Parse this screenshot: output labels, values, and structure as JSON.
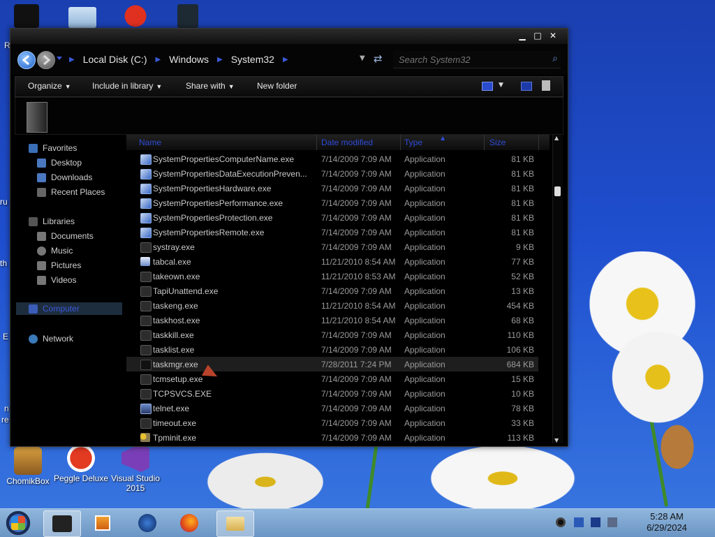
{
  "window": {
    "controls": {
      "minimize": "▁",
      "maximize": "□",
      "close": "✕"
    }
  },
  "breadcrumb": [
    "Local Disk (C:)",
    "Windows",
    "System32"
  ],
  "search": {
    "placeholder": "Search System32"
  },
  "toolbar": {
    "organize": "Organize",
    "include": "Include in library",
    "share": "Share with",
    "new_folder": "New folder"
  },
  "nav": {
    "favorites": "Favorites",
    "desktop": "Desktop",
    "downloads": "Downloads",
    "recent": "Recent Places",
    "libraries": "Libraries",
    "documents": "Documents",
    "music": "Music",
    "pictures": "Pictures",
    "videos": "Videos",
    "computer": "Computer",
    "network": "Network"
  },
  "columns": {
    "name": "Name",
    "date": "Date modified",
    "type": "Type",
    "size": "Size"
  },
  "files": [
    {
      "name": "SystemPropertiesComputerName.exe",
      "date": "7/14/2009 7:09 AM",
      "type": "Application",
      "size": "81 KB",
      "icon": "sysprop"
    },
    {
      "name": "SystemPropertiesDataExecutionPreven...",
      "date": "7/14/2009 7:09 AM",
      "type": "Application",
      "size": "81 KB",
      "icon": "sysprop"
    },
    {
      "name": "SystemPropertiesHardware.exe",
      "date": "7/14/2009 7:09 AM",
      "type": "Application",
      "size": "81 KB",
      "icon": "sysprop"
    },
    {
      "name": "SystemPropertiesPerformance.exe",
      "date": "7/14/2009 7:09 AM",
      "type": "Application",
      "size": "81 KB",
      "icon": "sysprop"
    },
    {
      "name": "SystemPropertiesProtection.exe",
      "date": "7/14/2009 7:09 AM",
      "type": "Application",
      "size": "81 KB",
      "icon": "sysprop"
    },
    {
      "name": "SystemPropertiesRemote.exe",
      "date": "7/14/2009 7:09 AM",
      "type": "Application",
      "size": "81 KB",
      "icon": "sysprop"
    },
    {
      "name": "systray.exe",
      "date": "7/14/2009 7:09 AM",
      "type": "Application",
      "size": "9 KB",
      "icon": "exe"
    },
    {
      "name": "tabcal.exe",
      "date": "11/21/2010 8:54 AM",
      "type": "Application",
      "size": "77 KB",
      "icon": "tabcal"
    },
    {
      "name": "takeown.exe",
      "date": "11/21/2010 8:53 AM",
      "type": "Application",
      "size": "52 KB",
      "icon": "exe"
    },
    {
      "name": "TapiUnattend.exe",
      "date": "7/14/2009 7:09 AM",
      "type": "Application",
      "size": "13 KB",
      "icon": "exe"
    },
    {
      "name": "taskeng.exe",
      "date": "11/21/2010 8:54 AM",
      "type": "Application",
      "size": "454 KB",
      "icon": "exe"
    },
    {
      "name": "taskhost.exe",
      "date": "11/21/2010 8:54 AM",
      "type": "Application",
      "size": "68 KB",
      "icon": "exe"
    },
    {
      "name": "taskkill.exe",
      "date": "7/14/2009 7:09 AM",
      "type": "Application",
      "size": "110 KB",
      "icon": "exe"
    },
    {
      "name": "tasklist.exe",
      "date": "7/14/2009 7:09 AM",
      "type": "Application",
      "size": "106 KB",
      "icon": "exe"
    },
    {
      "name": "taskmgr.exe",
      "date": "7/28/2011 7:24 PM",
      "type": "Application",
      "size": "684 KB",
      "icon": "taskmgr"
    },
    {
      "name": "tcmsetup.exe",
      "date": "7/14/2009 7:09 AM",
      "type": "Application",
      "size": "15 KB",
      "icon": "exe"
    },
    {
      "name": "TCPSVCS.EXE",
      "date": "7/14/2009 7:09 AM",
      "type": "Application",
      "size": "10 KB",
      "icon": "exe"
    },
    {
      "name": "telnet.exe",
      "date": "7/14/2009 7:09 AM",
      "type": "Application",
      "size": "78 KB",
      "icon": "telnet"
    },
    {
      "name": "timeout.exe",
      "date": "7/14/2009 7:09 AM",
      "type": "Application",
      "size": "33 KB",
      "icon": "exe"
    },
    {
      "name": "Tpminit.exe",
      "date": "7/14/2009 7:09 AM",
      "type": "Application",
      "size": "113 KB",
      "icon": "key"
    }
  ],
  "selected_file": "taskmgr.exe",
  "desktop_icons": [
    {
      "label": "ChomikBox"
    },
    {
      "label": "Peggle Deluxe"
    },
    {
      "label": "Visual Studio 2015"
    }
  ],
  "desktop_partial_labels": [
    "R",
    "ru",
    "th",
    "E",
    "n",
    "re"
  ],
  "clock": {
    "time": "5:28 AM",
    "date": "6/29/2024"
  },
  "colors": {
    "accent_blue": "#2f4bd8",
    "window_bg": "#000000",
    "taskbar": "#7fa6d2"
  }
}
